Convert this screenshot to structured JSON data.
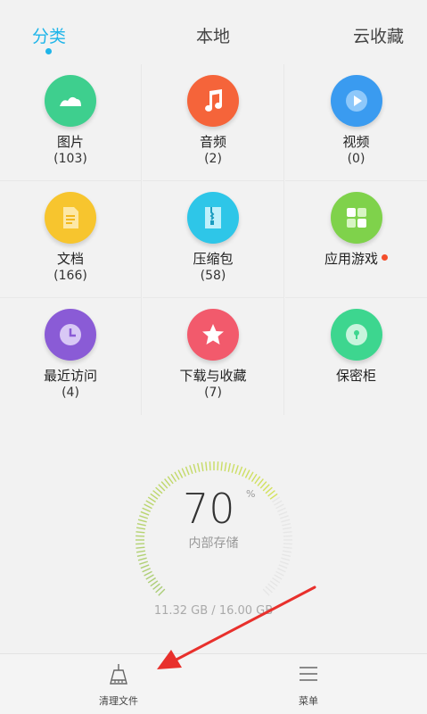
{
  "tabs": [
    {
      "label": "分类",
      "active": true
    },
    {
      "label": "本地",
      "active": false
    },
    {
      "label": "云收藏",
      "active": false
    }
  ],
  "categories": [
    {
      "label": "图片",
      "count": "(103)",
      "icon": "image-icon",
      "color": "#3ecf8e"
    },
    {
      "label": "音频",
      "count": "(2)",
      "icon": "music-icon",
      "color": "#f5643a"
    },
    {
      "label": "视频",
      "count": "(0)",
      "icon": "video-icon",
      "color": "#3a9bf0"
    },
    {
      "label": "文档",
      "count": "(166)",
      "icon": "document-icon",
      "color": "#f7c52e"
    },
    {
      "label": "压缩包",
      "count": "(58)",
      "icon": "zip-icon",
      "color": "#2ec6e8"
    },
    {
      "label": "应用游戏",
      "count": "",
      "icon": "apps-icon",
      "color": "#7fd24b",
      "badge": true
    },
    {
      "label": "最近访问",
      "count": "(4)",
      "icon": "clock-icon",
      "color": "#8a5bd6"
    },
    {
      "label": "下载与收藏",
      "count": "(7)",
      "icon": "star-icon",
      "color": "#f25a6c"
    },
    {
      "label": "保密柜",
      "count": "",
      "icon": "lock-icon",
      "color": "#3dd68f"
    }
  ],
  "storage": {
    "percent": "70",
    "percent_sign": "%",
    "percent_value": 0.7,
    "label": "内部存储",
    "size": "11.32 GB / 16.00 GB"
  },
  "bottom": {
    "clean_label": "清理文件",
    "menu_label": "菜单"
  },
  "colors": {
    "accent": "#1fb5e9",
    "badge": "#f44e2c",
    "arrow": "#e8302c"
  }
}
